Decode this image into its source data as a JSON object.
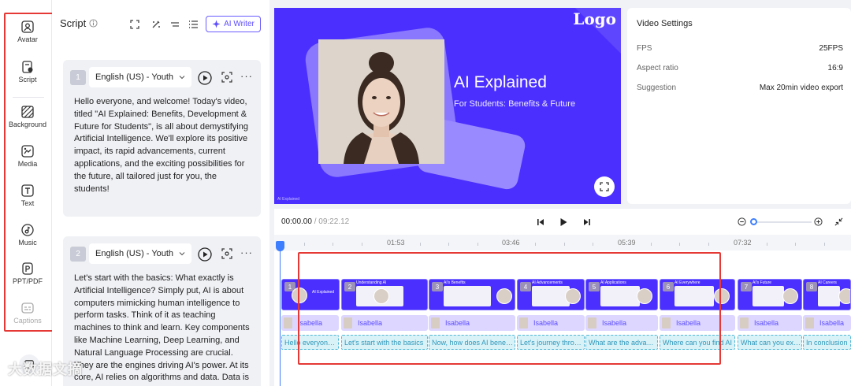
{
  "rail": {
    "items": [
      {
        "label": "Avatar",
        "icon": "avatar-icon"
      },
      {
        "label": "Script",
        "icon": "script-icon"
      },
      {
        "label": "Background",
        "icon": "background-icon"
      },
      {
        "label": "Media",
        "icon": "media-icon"
      },
      {
        "label": "Text",
        "icon": "text-icon"
      },
      {
        "label": "Music",
        "icon": "music-icon"
      },
      {
        "label": "PPT/PDF",
        "icon": "ppt-pdf-icon"
      },
      {
        "label": "Captions",
        "icon": "captions-icon",
        "disabled": true
      }
    ]
  },
  "script": {
    "title": "Script",
    "ai_writer": "AI Writer",
    "cards": [
      {
        "num": "1",
        "language": "English (US) - Youth",
        "text": "Hello everyone, and welcome! Today's video, titled \"AI Explained: Benefits, Development & Future for Students\", is all about demystifying Artificial Intelligence. We'll explore its positive impact, its rapid advancements, current applications, and the exciting possibilities for the future, all tailored just for you, the students!"
      },
      {
        "num": "2",
        "language": "English (US) - Youth",
        "text": "Let's start with the basics: What exactly is Artificial Intelligence? Simply put, AI is about computers mimicking human intelligence to perform tasks. Think of it as teaching machines to think and learn. Key components like Machine Learning, Deep Learning, and Natural Language Processing are crucial. They are the engines driving AI's power. At its core, AI relies on algorithms and data. Data is"
      }
    ]
  },
  "preview": {
    "logo": "Logo",
    "title": "AI Explained",
    "subtitle": "For Students: Benefits & Future",
    "footer_tiny": "AI Explained"
  },
  "settings": {
    "title": "Video Settings",
    "rows": [
      {
        "label": "FPS",
        "value": "25FPS"
      },
      {
        "label": "Aspect ratio",
        "value": "16:9"
      },
      {
        "label": "Suggestion",
        "value": "Max 20min video export"
      }
    ]
  },
  "timeline": {
    "current": "00:00.00",
    "total": "/ 09:22.12",
    "ticks": [
      "01:53",
      "03:46",
      "05:39",
      "07:32"
    ],
    "scenes": [
      {
        "num": "1",
        "label": "AI Explained"
      },
      {
        "num": "2",
        "label": "Understanding AI"
      },
      {
        "num": "3",
        "label": "AI's Benefits"
      },
      {
        "num": "4",
        "label": "AI Advancements"
      },
      {
        "num": "5",
        "label": "AI Applications"
      },
      {
        "num": "6",
        "label": "AI Everywhere"
      },
      {
        "num": "7",
        "label": "AI's Future"
      },
      {
        "num": "8",
        "label": "AI Careers"
      }
    ],
    "avatar_name": "Isabella",
    "captions": [
      "Hello everyone, and welcome!",
      "Let's start with the basics",
      "Now, how does AI benefit you",
      "Let's journey through AI",
      "What are the advancements",
      "Where can you find AI",
      "What can you expect",
      "In conclusion"
    ]
  },
  "watermark": "大数据文摘"
}
